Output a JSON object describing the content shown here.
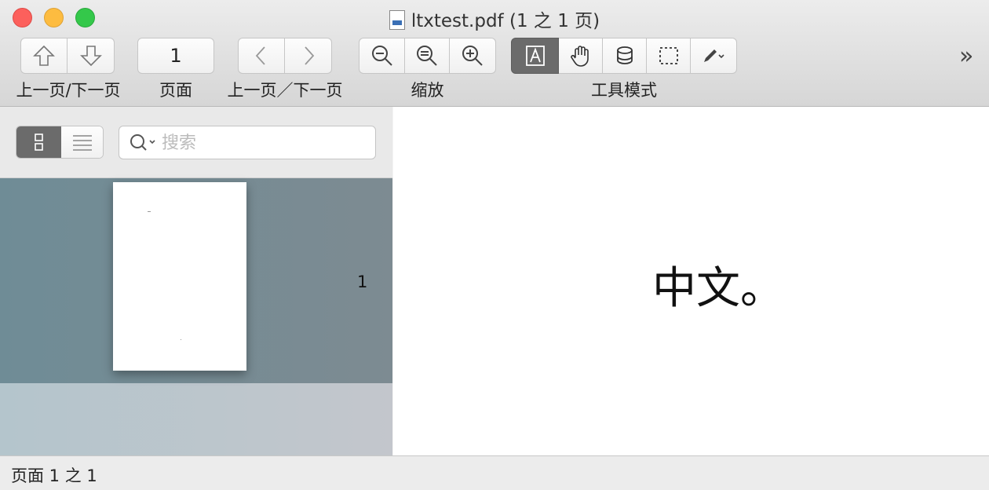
{
  "window": {
    "title": "ltxtest.pdf (1 之 1 页)"
  },
  "toolbar": {
    "page_number": "1",
    "labels": {
      "prev_next_1": "上一页/下一页",
      "page": "页面",
      "prev_next_2": "上一页／下一页",
      "zoom": "缩放",
      "tool_mode": "工具模式"
    },
    "overflow_glyph": "»"
  },
  "sidebar": {
    "search_placeholder": "搜索",
    "thumbnail_page": "1"
  },
  "document": {
    "text": "中文。"
  },
  "status": {
    "text": "页面 1 之 1"
  },
  "colors": {
    "active_tool": "#6b6b6b",
    "thumb_selection": "#788c94"
  }
}
